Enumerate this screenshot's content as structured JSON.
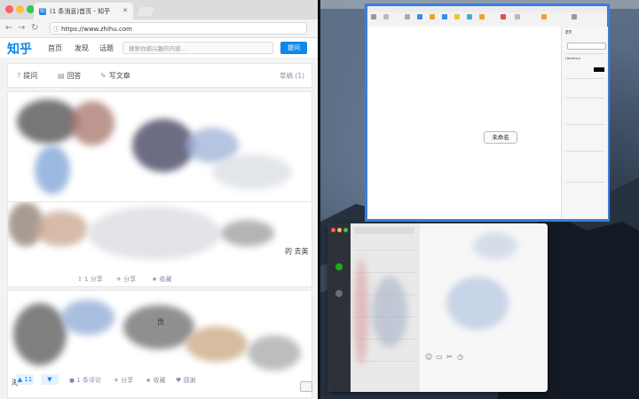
{
  "browser": {
    "tab_title": "(1 条消息)首页 - 知乎",
    "tab_favicon": "知",
    "user_label": "",
    "url": "https://www.zhihu.com",
    "info_icon": "ⓘ"
  },
  "zhihu": {
    "logo": "知乎",
    "nav": [
      "首页",
      "发现",
      "话题"
    ],
    "search_placeholder": "搜索你感兴趣的内容...",
    "ask_button": "提问",
    "actions": {
      "ask": "提问",
      "answer": "回答",
      "article": "写文章",
      "drafts": "草稿 (1)"
    },
    "card1": {
      "snippet_end": "的 去英",
      "meta": {
        "share": "分享",
        "favorite": "收藏"
      }
    },
    "card2": {
      "snippet_start": "",
      "snippet_mid": "页",
      "snippet_tail": "海"
    },
    "footer": {
      "vote_up": "▲ 11",
      "vote_down": "▼",
      "comments": "1 条评论",
      "share": "分享",
      "favorite": "收藏",
      "thanks": "感谢"
    }
  },
  "pages_app": {
    "title": "",
    "placeholder_label": "未命名",
    "inspector_heading": "正文",
    "font_name": "Helvetica"
  },
  "colors": {
    "zhihu_blue": "#0f88eb",
    "selection_blue": "#3b7ddd",
    "wechat_green": "#1aad19"
  }
}
